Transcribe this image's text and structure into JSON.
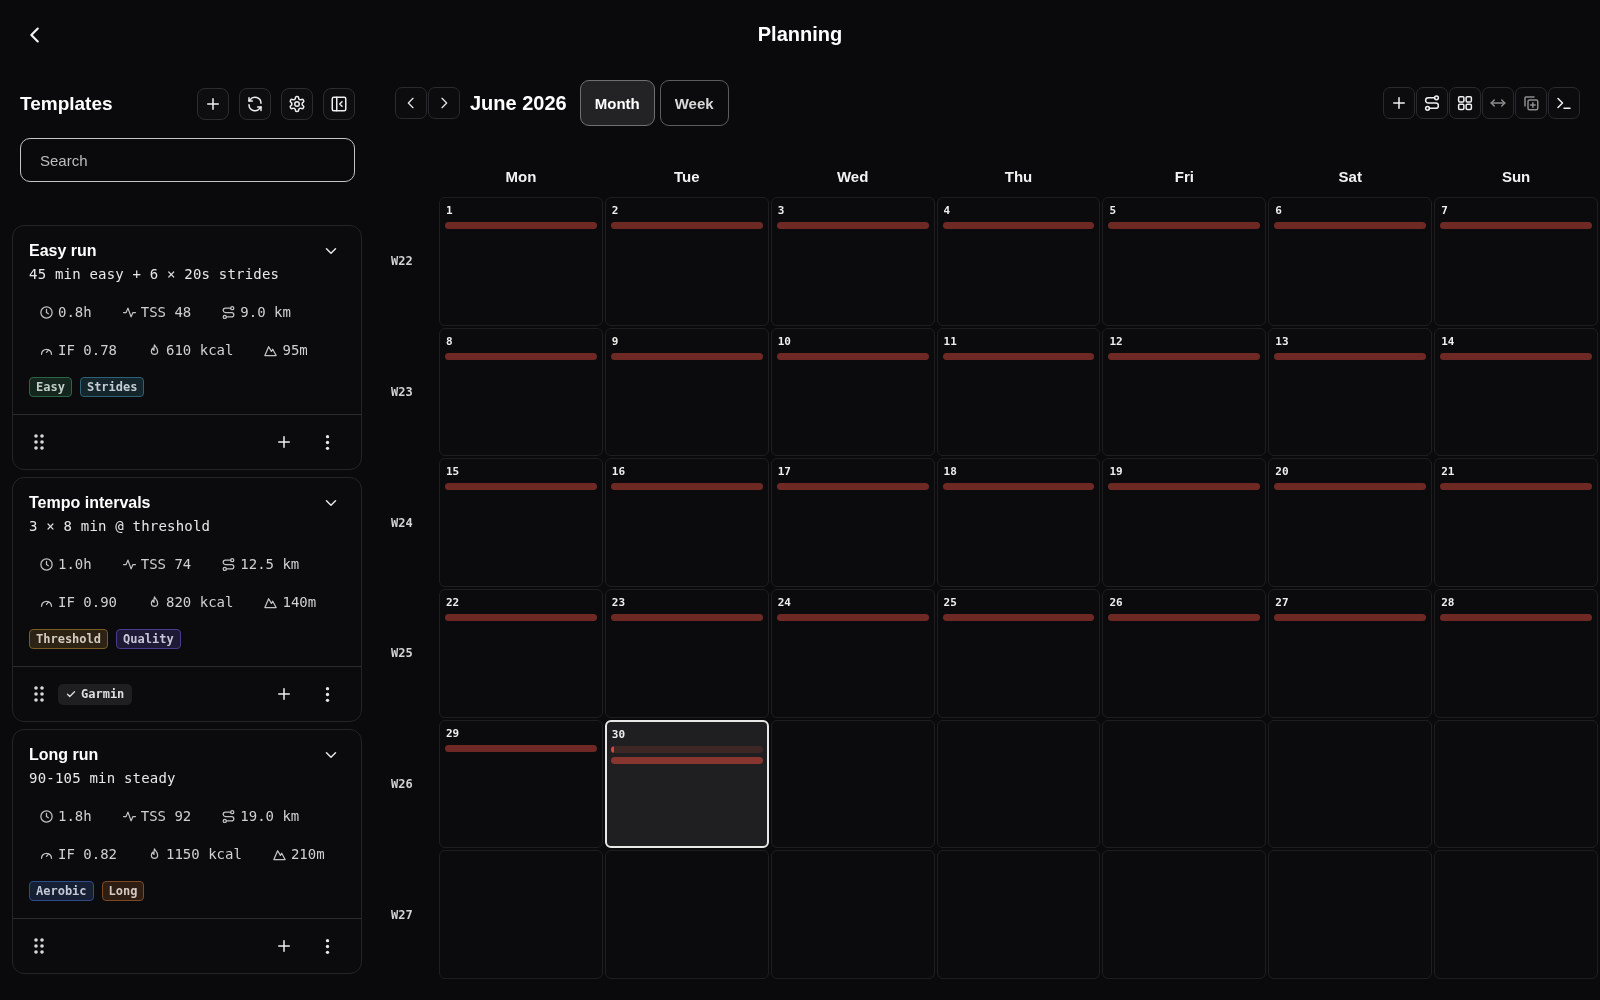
{
  "header": {
    "title": "Planning"
  },
  "sidebar": {
    "title": "Templates",
    "tools": [
      {
        "kind": "add"
      },
      {
        "kind": "refresh"
      },
      {
        "kind": "settings"
      },
      {
        "kind": "collapse"
      }
    ],
    "search": {
      "placeholder": "Search"
    },
    "templates": [
      {
        "title": "Easy run",
        "subtitle": "45 min easy + 6 × 20s strides",
        "stats": [
          {
            "kind": "duration",
            "text": "0.8h"
          },
          {
            "kind": "load",
            "text": "TSS 48"
          },
          {
            "kind": "distance",
            "text": "9.0 km"
          },
          {
            "kind": "intensity",
            "text": "IF 0.78"
          },
          {
            "kind": "energy",
            "text": "610 kcal"
          },
          {
            "kind": "elevation",
            "text": "95m"
          }
        ],
        "tags": [
          {
            "label": "Easy",
            "color": "#2c6446"
          },
          {
            "label": "Strides",
            "color": "#2d6275"
          }
        ]
      },
      {
        "title": "Tempo intervals",
        "subtitle": "3 × 8 min @ threshold",
        "stats": [
          {
            "kind": "duration",
            "text": "1.0h"
          },
          {
            "kind": "load",
            "text": "TSS 74"
          },
          {
            "kind": "distance",
            "text": "12.5 km"
          },
          {
            "kind": "intensity",
            "text": "IF 0.90"
          },
          {
            "kind": "energy",
            "text": "820 kcal"
          },
          {
            "kind": "elevation",
            "text": "140m"
          }
        ],
        "tags": [
          {
            "label": "Threshold",
            "color": "#7b5a26"
          },
          {
            "label": "Quality",
            "color": "#4a3b8e"
          }
        ],
        "badge": {
          "label": "Garmin",
          "checked": true
        }
      },
      {
        "title": "Long run",
        "subtitle": "90-105 min steady",
        "stats": [
          {
            "kind": "duration",
            "text": "1.8h"
          },
          {
            "kind": "load",
            "text": "TSS 92"
          },
          {
            "kind": "distance",
            "text": "19.0 km"
          },
          {
            "kind": "intensity",
            "text": "IF 0.82"
          },
          {
            "kind": "energy",
            "text": "1150 kcal"
          },
          {
            "kind": "elevation",
            "text": "210m"
          }
        ],
        "tags": [
          {
            "label": "Aerobic",
            "color": "#2e4c8a"
          },
          {
            "label": "Long",
            "color": "#7d4822"
          }
        ]
      }
    ]
  },
  "calendar": {
    "month": "June 2026",
    "views": [
      {
        "label": "Month",
        "selected": true
      },
      {
        "label": "Week",
        "selected": false
      }
    ],
    "actions": [
      {
        "kind": "add",
        "disabled": false
      },
      {
        "kind": "route",
        "disabled": false
      },
      {
        "kind": "grid",
        "disabled": false
      },
      {
        "kind": "swap",
        "disabled": true
      },
      {
        "kind": "duplicate",
        "disabled": true
      },
      {
        "kind": "terminal",
        "disabled": false
      }
    ],
    "weekdays": [
      "Mon",
      "Tue",
      "Wed",
      "Thu",
      "Fri",
      "Sat",
      "Sun"
    ],
    "weeks": [
      {
        "label": "W22",
        "days": [
          {
            "kind": "day",
            "date": "1",
            "selected": false,
            "entries": [
              {
                "kind": "bar"
              }
            ]
          },
          {
            "kind": "day",
            "date": "2",
            "selected": false,
            "entries": [
              {
                "kind": "bar"
              }
            ]
          },
          {
            "kind": "day",
            "date": "3",
            "selected": false,
            "entries": [
              {
                "kind": "bar"
              }
            ]
          },
          {
            "kind": "day",
            "date": "4",
            "selected": false,
            "entries": [
              {
                "kind": "bar"
              }
            ]
          },
          {
            "kind": "day",
            "date": "5",
            "selected": false,
            "entries": [
              {
                "kind": "bar"
              }
            ]
          },
          {
            "kind": "day",
            "date": "6",
            "selected": false,
            "entries": [
              {
                "kind": "bar"
              }
            ]
          },
          {
            "kind": "day",
            "date": "7",
            "selected": false,
            "entries": [
              {
                "kind": "bar"
              }
            ]
          }
        ]
      },
      {
        "label": "W23",
        "days": [
          {
            "kind": "day",
            "date": "8",
            "selected": false,
            "entries": [
              {
                "kind": "bar"
              }
            ]
          },
          {
            "kind": "day",
            "date": "9",
            "selected": false,
            "entries": [
              {
                "kind": "bar"
              }
            ]
          },
          {
            "kind": "day",
            "date": "10",
            "selected": false,
            "entries": [
              {
                "kind": "bar"
              }
            ]
          },
          {
            "kind": "day",
            "date": "11",
            "selected": false,
            "entries": [
              {
                "kind": "bar"
              }
            ]
          },
          {
            "kind": "day",
            "date": "12",
            "selected": false,
            "entries": [
              {
                "kind": "bar"
              }
            ]
          },
          {
            "kind": "day",
            "date": "13",
            "selected": false,
            "entries": [
              {
                "kind": "bar"
              }
            ]
          },
          {
            "kind": "day",
            "date": "14",
            "selected": false,
            "entries": [
              {
                "kind": "bar"
              }
            ]
          }
        ]
      },
      {
        "label": "W24",
        "days": [
          {
            "kind": "day",
            "date": "15",
            "selected": false,
            "entries": [
              {
                "kind": "bar"
              }
            ]
          },
          {
            "kind": "day",
            "date": "16",
            "selected": false,
            "entries": [
              {
                "kind": "bar"
              }
            ]
          },
          {
            "kind": "day",
            "date": "17",
            "selected": false,
            "entries": [
              {
                "kind": "bar"
              }
            ]
          },
          {
            "kind": "day",
            "date": "18",
            "selected": false,
            "entries": [
              {
                "kind": "bar"
              }
            ]
          },
          {
            "kind": "day",
            "date": "19",
            "selected": false,
            "entries": [
              {
                "kind": "bar"
              }
            ]
          },
          {
            "kind": "day",
            "date": "20",
            "selected": false,
            "entries": [
              {
                "kind": "bar"
              }
            ]
          },
          {
            "kind": "day",
            "date": "21",
            "selected": false,
            "entries": [
              {
                "kind": "bar"
              }
            ]
          }
        ]
      },
      {
        "label": "W25",
        "days": [
          {
            "kind": "day",
            "date": "22",
            "selected": false,
            "entries": [
              {
                "kind": "bar"
              }
            ]
          },
          {
            "kind": "day",
            "date": "23",
            "selected": false,
            "entries": [
              {
                "kind": "bar"
              }
            ]
          },
          {
            "kind": "day",
            "date": "24",
            "selected": false,
            "entries": [
              {
                "kind": "bar"
              }
            ]
          },
          {
            "kind": "day",
            "date": "25",
            "selected": false,
            "entries": [
              {
                "kind": "bar"
              }
            ]
          },
          {
            "kind": "day",
            "date": "26",
            "selected": false,
            "entries": [
              {
                "kind": "bar"
              }
            ]
          },
          {
            "kind": "day",
            "date": "27",
            "selected": false,
            "entries": [
              {
                "kind": "bar"
              }
            ]
          },
          {
            "kind": "day",
            "date": "28",
            "selected": false,
            "entries": [
              {
                "kind": "bar"
              }
            ]
          }
        ]
      },
      {
        "label": "W26",
        "days": [
          {
            "kind": "day",
            "date": "29",
            "selected": false,
            "entries": [
              {
                "kind": "bar"
              }
            ]
          },
          {
            "kind": "day",
            "date": "30",
            "selected": true,
            "entries": [
              {
                "kind": "meter",
                "level": 0.02
              },
              {
                "kind": "bar"
              }
            ]
          },
          {
            "kind": "empty"
          },
          {
            "kind": "empty"
          },
          {
            "kind": "empty"
          },
          {
            "kind": "empty"
          },
          {
            "kind": "empty"
          }
        ]
      },
      {
        "label": "W27",
        "days": [
          {
            "kind": "empty"
          },
          {
            "kind": "empty"
          },
          {
            "kind": "empty"
          },
          {
            "kind": "empty"
          },
          {
            "kind": "empty"
          },
          {
            "kind": "empty"
          },
          {
            "kind": "empty"
          }
        ]
      }
    ]
  }
}
